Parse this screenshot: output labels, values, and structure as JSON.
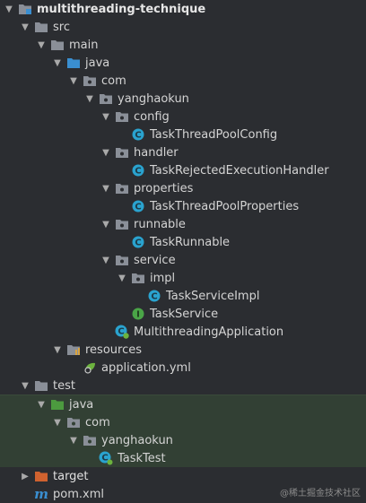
{
  "project": {
    "root": "multithreading-technique",
    "src": "src",
    "main": "main",
    "java": "java",
    "com": "com",
    "pkg": "yanghaokun",
    "config": "config",
    "TaskThreadPoolConfig": "TaskThreadPoolConfig",
    "handler": "handler",
    "TaskRejectedExecutionHandler": "TaskRejectedExecutionHandler",
    "properties": "properties",
    "TaskThreadPoolProperties": "TaskThreadPoolProperties",
    "runnable": "runnable",
    "TaskRunnable": "TaskRunnable",
    "service": "service",
    "impl": "impl",
    "TaskServiceImpl": "TaskServiceImpl",
    "TaskService": "TaskService",
    "MultithreadingApplication": "MultithreadingApplication",
    "resources": "resources",
    "application_yml": "application.yml",
    "test": "test",
    "test_java": "java",
    "test_com": "com",
    "test_pkg": "yanghaokun",
    "TaskTest": "TaskTest",
    "target": "target",
    "pom": "pom.xml"
  },
  "icons": {
    "class": "C",
    "interface": "I",
    "maven": "m"
  },
  "colors": {
    "background": "#2b2d31",
    "test_background": "#324034",
    "folder": "#8a8f98",
    "source_folder": "#3a8fd1",
    "test_folder": "#4c9a3f",
    "excluded_folder": "#d0622f",
    "class_icon": "#2aa3cf",
    "interface_icon": "#4aa547"
  },
  "watermark": "@稀土掘金技术社区"
}
